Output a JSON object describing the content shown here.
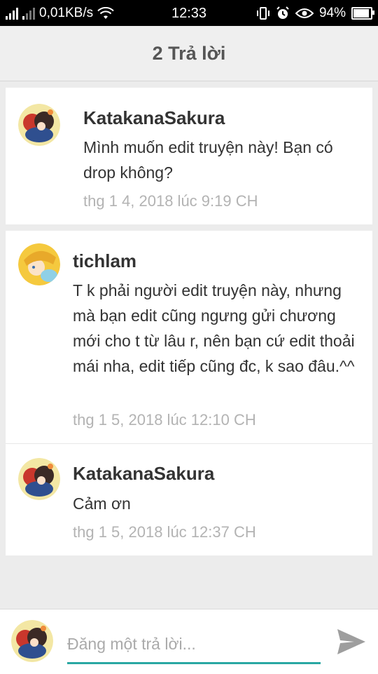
{
  "status_bar": {
    "network_speed": "0,01KB/s",
    "time": "12:33",
    "battery_percent": "94%",
    "battery_level": 0.94,
    "icons": [
      "signal-icon",
      "wifi-icon",
      "vibrate-icon",
      "alarm-icon",
      "eye-icon",
      "battery-icon"
    ]
  },
  "header": {
    "title": "2 Trả lời"
  },
  "comments": [
    {
      "author": "KatakanaSakura",
      "text": "Mình muốn edit truyện này! Bạn có drop không?",
      "time": "thg 1 4, 2018 lúc 9:19 CH"
    },
    {
      "author": "tichlam",
      "text": "T k phải người edit truyện này, nhưng mà bạn edit cũng ngưng gửi chương mới cho t từ lâu r, nên bạn cứ edit thoải mái nha, edit tiếp cũng đc, k sao đâu.^^",
      "time": "thg 1 5, 2018 lúc 12:10 CH"
    },
    {
      "author": "KatakanaSakura",
      "text": "Cảm ơn",
      "time": "thg 1 5, 2018 lúc 12:37 CH"
    }
  ],
  "reply": {
    "placeholder": "Đăng một trả lời...",
    "value": ""
  },
  "colors": {
    "accent": "#2aa7a3",
    "background": "#ececec",
    "card": "#ffffff",
    "timestamp": "#b3b3b3"
  }
}
